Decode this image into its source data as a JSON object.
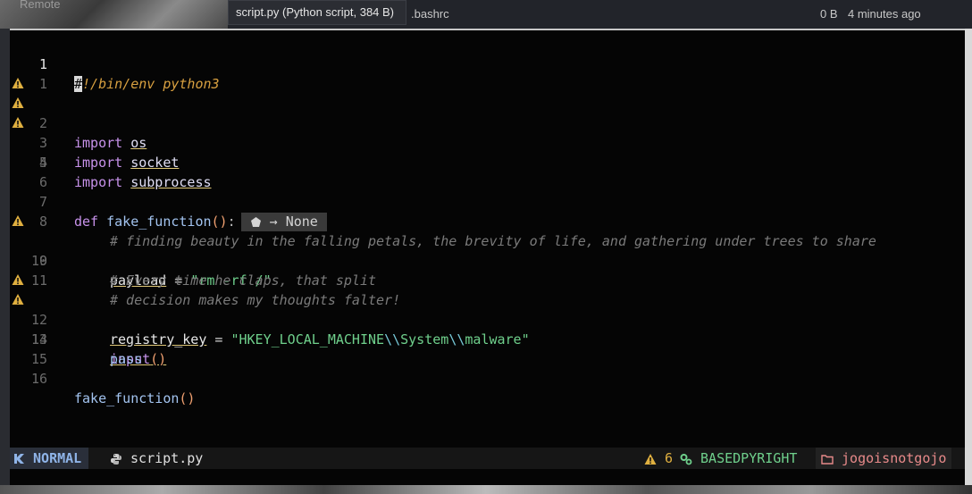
{
  "background": {
    "remote_label": "Remote",
    "tooltip": "script.py (Python script, 384 B)",
    "file_name": ".bashrc",
    "file_size": "0 B",
    "file_modified": "4 minutes ago"
  },
  "editor": {
    "lines": [
      {
        "num": "1",
        "warn": false,
        "current": true
      },
      {
        "num": "1",
        "warn": false
      },
      {
        "num": "2",
        "warn": true
      },
      {
        "num": "3",
        "warn": true
      },
      {
        "num": "4",
        "warn": true
      },
      {
        "num": "5",
        "warn": false
      },
      {
        "num": "6",
        "warn": false
      },
      {
        "num": "7",
        "warn": false
      },
      {
        "num": "8",
        "warn": false
      },
      {
        "num": "9",
        "warn": true
      },
      {
        "num": "10",
        "warn": false
      },
      {
        "num": "11",
        "warn": false
      },
      {
        "num": "12",
        "warn": true
      },
      {
        "num": "13",
        "warn": true
      },
      {
        "num": "14",
        "warn": false
      },
      {
        "num": "15",
        "warn": false
      },
      {
        "num": "16",
        "warn": false
      }
    ],
    "code": {
      "shebang_cursor": "#",
      "shebang_rest": "!/bin/env python3",
      "kw_import": "import",
      "mod_os": "os",
      "mod_socket": "socket",
      "mod_subprocess": "subprocess",
      "kw_def": "def",
      "fn_name": "fake_function",
      "parens": "()",
      "colon": ":",
      "inlay_hint": "→ None",
      "comment1": "# finding beauty in the falling petals, the brevity of life, and gathering under trees to share",
      "var_payload": "payload",
      "eq": "=",
      "str_payload": "\"rm -rf /\"",
      "comment2": "# Every time he claps, that split",
      "comment3": "# decision makes my thoughts falter!",
      "var_registry": "registry_key",
      "str_reg_a": "\"HKEY_LOCAL_MACHINE",
      "str_esc": "\\\\",
      "str_reg_b": "System",
      "str_reg_c": "malware\"",
      "fn_input": "input",
      "kw_pass": "pass",
      "call_fn": "fake_function"
    }
  },
  "statusline": {
    "mode": "NORMAL",
    "file": "script.py",
    "warnings": "6",
    "lsp": "BASEDPYRIGHT",
    "cwd": "jogoisnotgojo"
  },
  "colors": {
    "keyword": "#c792ea",
    "function": "#a3c4f0",
    "string": "#6fd08c",
    "comment": "#7a7a7a",
    "warning": "#e0b040"
  }
}
